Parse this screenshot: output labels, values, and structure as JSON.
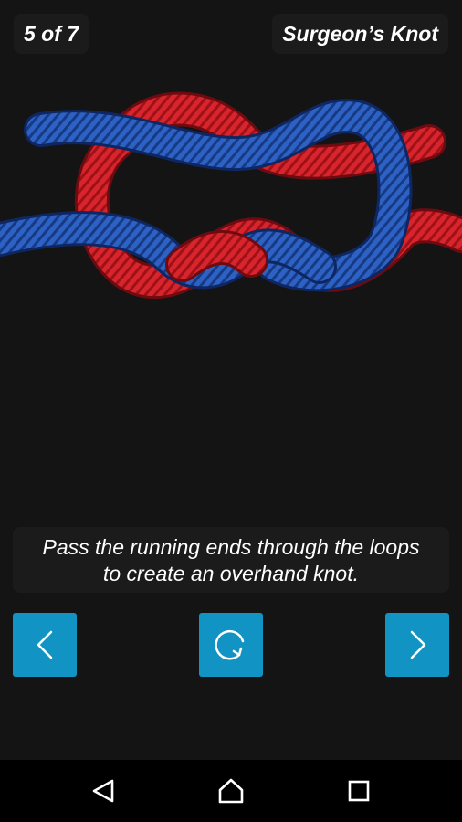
{
  "header": {
    "step_label": "5 of 7",
    "knot_name": "Surgeon’s Knot"
  },
  "illustration": {
    "subject": "Surgeon's knot with red and blue ropes",
    "rope_colors": [
      "#d8242c",
      "#2759b8"
    ]
  },
  "instruction": {
    "line1": "Pass the running ends through the loops",
    "line2": "to create an overhand knot."
  },
  "controls": {
    "prev_icon": "chevron-left-icon",
    "replay_icon": "replay-icon",
    "next_icon": "chevron-right-icon",
    "button_color": "#1193c3"
  },
  "system_nav": {
    "back_icon": "back-triangle-icon",
    "home_icon": "home-icon",
    "recent_icon": "recent-apps-icon"
  }
}
